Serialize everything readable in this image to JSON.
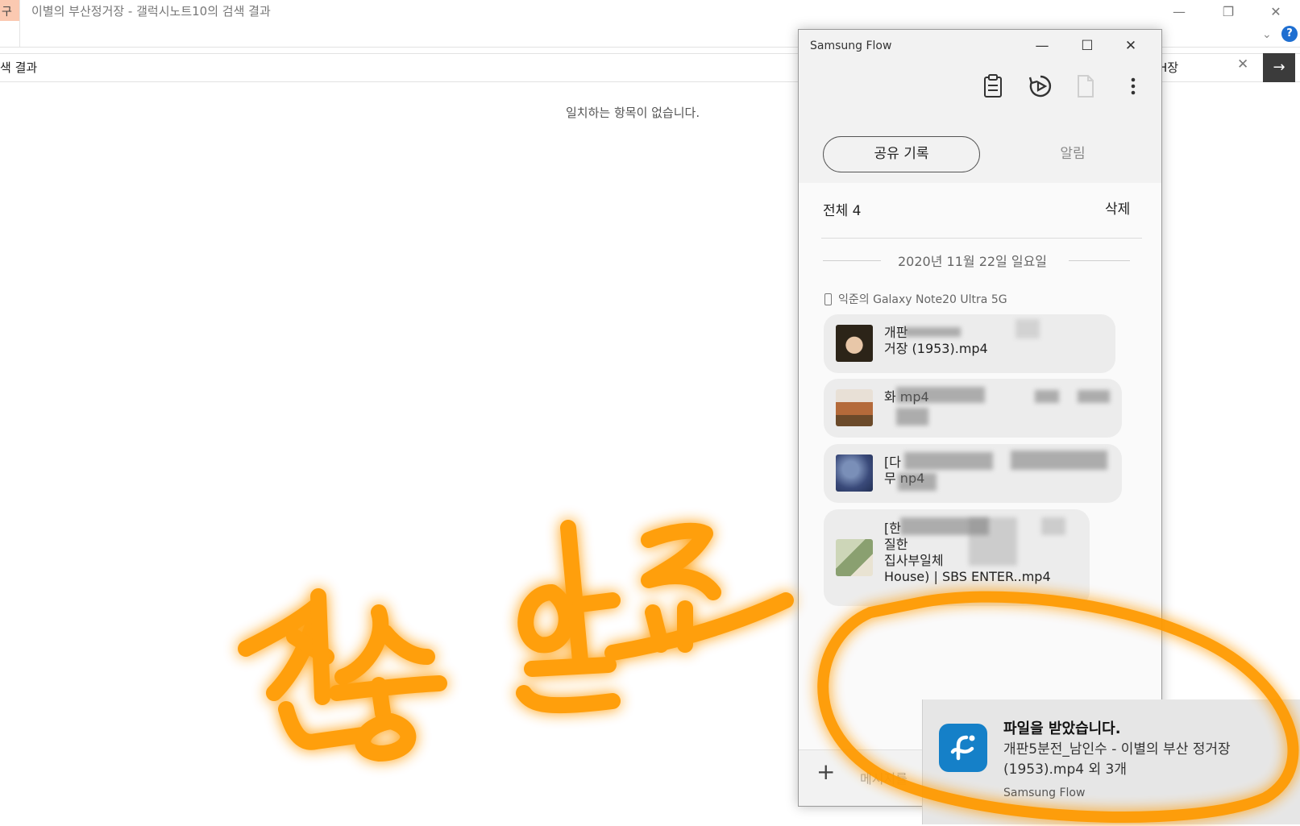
{
  "explorer": {
    "tab_stub": "구",
    "title": "이별의 부산정거장 - 갤럭시노트10의 검색 결과",
    "address": "색 결과",
    "search_value": "H장",
    "empty_message": "일치하는 항목이 없습니다.",
    "help_label": "?"
  },
  "flow": {
    "title": "Samsung Flow",
    "tabs": {
      "history": "공유 기록",
      "alarm": "알림"
    },
    "total_label": "전체 4",
    "delete_label": "삭제",
    "date": "2020년 11월 22일 일요일",
    "device": "익준의 Galaxy Note20 Ultra 5G",
    "items": [
      {
        "line1": "개판",
        "line2": "거장 (1953).mp4"
      },
      {
        "line1": "",
        "line2": "화       mp4"
      },
      {
        "line1": "[다",
        "line2": "무         np4"
      },
      {
        "line1": "[한",
        "line2": "질한",
        "line3": "집사부일체",
        "line4": "House) | SBS ENTER..mp4"
      }
    ],
    "message_placeholder": "메시지를"
  },
  "toast": {
    "title": "파일을 받았습니다.",
    "body": "개판5분전_남인수 - 이별의 부산 정거장 (1953).mp4 외 3개",
    "app": "Samsung Flow"
  },
  "colors": {
    "accent": "#1580c8",
    "annotation": "#ff9a00",
    "help": "#1f6fd1"
  },
  "icons": [
    "clipboard-icon",
    "screen-mirror-icon",
    "file-icon",
    "more-icon",
    "phone-icon",
    "samsung-flow-icon",
    "plus-icon"
  ]
}
